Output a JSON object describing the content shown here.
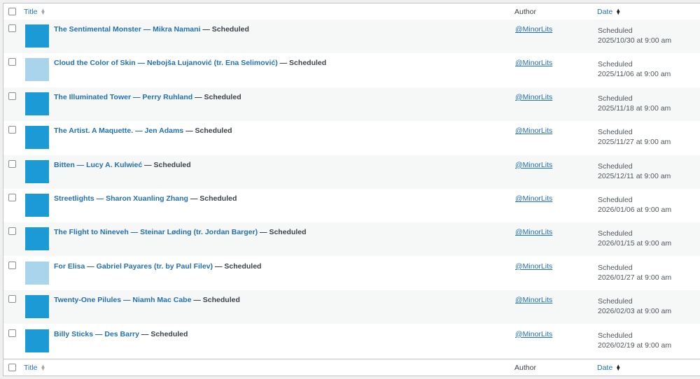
{
  "header": {
    "title_label": "Title",
    "author_label": "Author",
    "date_label": "Date"
  },
  "footer": {
    "title_label": "Title",
    "author_label": "Author",
    "date_label": "Date"
  },
  "sort_glyphs": {
    "up": "▲",
    "down": "▼"
  },
  "rows": [
    {
      "title": "The Sentimental Monster — Mikra Namani",
      "state": "— Scheduled",
      "author": "@MinorLits",
      "status": "Scheduled",
      "datetime": "2025/10/30 at 9:00 am",
      "thumb": "dark"
    },
    {
      "title": "Cloud the Color of Skin — Nebojša Lujanović (tr. Ena Selimović)",
      "state": "— Scheduled",
      "author": "@MinorLits",
      "status": "Scheduled",
      "datetime": "2025/11/06 at 9:00 am",
      "thumb": "light"
    },
    {
      "title": "The Illuminated Tower — Perry Ruhland",
      "state": "— Scheduled",
      "author": "@MinorLits",
      "status": "Scheduled",
      "datetime": "2025/11/18 at 9:00 am",
      "thumb": "dark"
    },
    {
      "title": "The Artist. A Maquette. — Jen Adams",
      "state": "— Scheduled",
      "author": "@MinorLits",
      "status": "Scheduled",
      "datetime": "2025/11/27 at 9:00 am",
      "thumb": "dark"
    },
    {
      "title": "Bitten — Lucy A. Kulwieć",
      "state": "— Scheduled",
      "author": "@MinorLits",
      "status": "Scheduled",
      "datetime": "2025/12/11 at 9:00 am",
      "thumb": "dark"
    },
    {
      "title": "Streetlights — Sharon Xuanling Zhang",
      "state": "— Scheduled",
      "author": "@MinorLits",
      "status": "Scheduled",
      "datetime": "2026/01/06 at 9:00 am",
      "thumb": "dark"
    },
    {
      "title": "The Flight to Nineveh — Steinar Løding (tr. Jordan Barger)",
      "state": "— Scheduled",
      "author": "@MinorLits",
      "status": "Scheduled",
      "datetime": "2026/01/15 at 9:00 am",
      "thumb": "dark"
    },
    {
      "title": "For Elisa — Gabriel Payares (tr. by Paul Filev)",
      "state": "— Scheduled",
      "author": "@MinorLits",
      "status": "Scheduled",
      "datetime": "2026/01/27 at 9:00 am",
      "thumb": "light"
    },
    {
      "title": "Twenty-One Pilules — Niamh Mac Cabe",
      "state": "— Scheduled",
      "author": "@MinorLits",
      "status": "Scheduled",
      "datetime": "2026/02/03 at 9:00 am",
      "thumb": "dark"
    },
    {
      "title": "Billy Sticks — Des Barry",
      "state": "— Scheduled",
      "author": "@MinorLits",
      "status": "Scheduled",
      "datetime": "2026/02/19 at 9:00 am",
      "thumb": "dark"
    }
  ]
}
